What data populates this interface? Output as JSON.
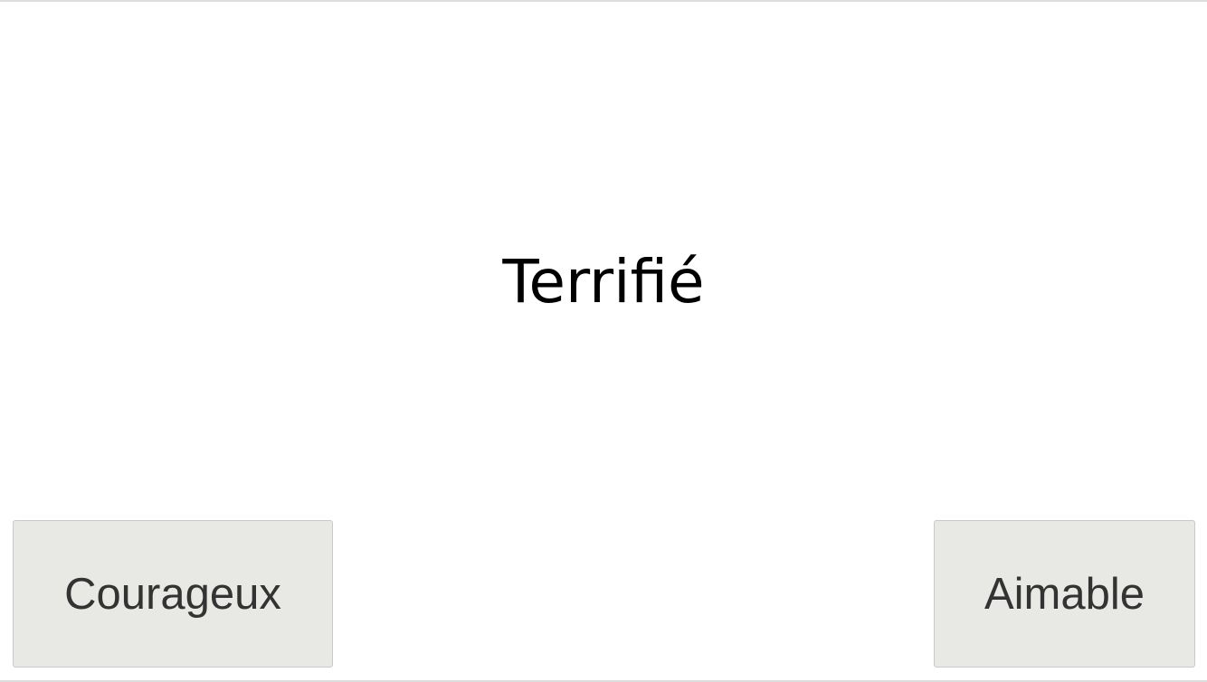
{
  "stimulus": {
    "word": "Terrifié"
  },
  "choices": {
    "left_label": "Courageux",
    "right_label": "Aimable"
  },
  "colors": {
    "background": "#ffffff",
    "button_fill": "#e8e8e4",
    "button_border": "#c9c9c5",
    "button_text": "#333333",
    "stimulus_text": "#000000"
  }
}
